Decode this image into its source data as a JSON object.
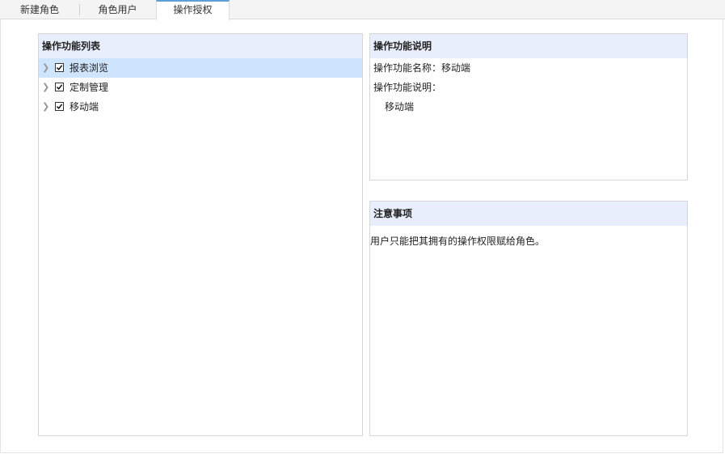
{
  "tabs": [
    {
      "label": "新建角色"
    },
    {
      "label": "角色用户"
    },
    {
      "label": "操作授权"
    }
  ],
  "active_tab": "操作授权",
  "function_list": {
    "title": "操作功能列表",
    "items": [
      {
        "label": "报表浏览",
        "checked": true,
        "selected": true
      },
      {
        "label": "定制管理",
        "checked": true,
        "selected": false
      },
      {
        "label": "移动端",
        "checked": true,
        "selected": false
      }
    ]
  },
  "function_desc": {
    "title": "操作功能说明",
    "name_label": "操作功能名称：",
    "name_value": "移动端",
    "desc_label": "操作功能说明：",
    "desc_value": "移动端"
  },
  "notes": {
    "title": "注意事项",
    "text": "用户只能把其拥有的操作权限赋给角色。"
  },
  "colors": {
    "header_bg": "#e8eefc",
    "selected_row": "#cfe5fd",
    "active_tab_accent": "#5aa0d9"
  }
}
